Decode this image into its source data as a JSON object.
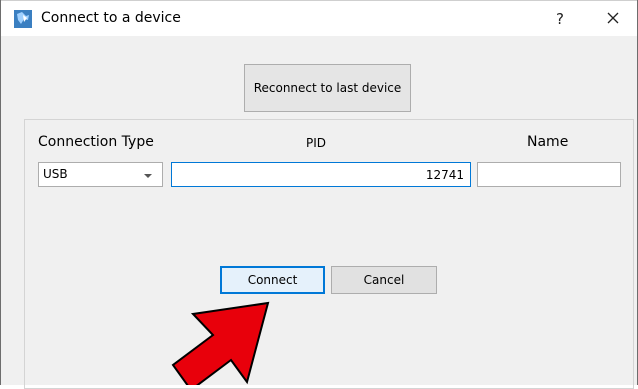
{
  "window": {
    "title": "Connect to a device",
    "help_label": "?"
  },
  "reconnect_label": "Reconnect to last device",
  "columns": {
    "connection_type": "Connection Type",
    "pid": "PID",
    "name": "Name"
  },
  "connection_type": {
    "value": "USB",
    "options": [
      "USB"
    ]
  },
  "pid": {
    "value": "12741",
    "placeholder": ""
  },
  "name_field": {
    "value": "",
    "placeholder": ""
  },
  "buttons": {
    "connect": "Connect",
    "cancel": "Cancel"
  },
  "colors": {
    "focus_accent": "#0078d7",
    "annotation_arrow": "#e8000b"
  },
  "icons": {
    "app": "app-logo-icon",
    "close": "close-icon",
    "dropdown": "chevron-down-icon",
    "annotation": "red-arrow-icon"
  }
}
